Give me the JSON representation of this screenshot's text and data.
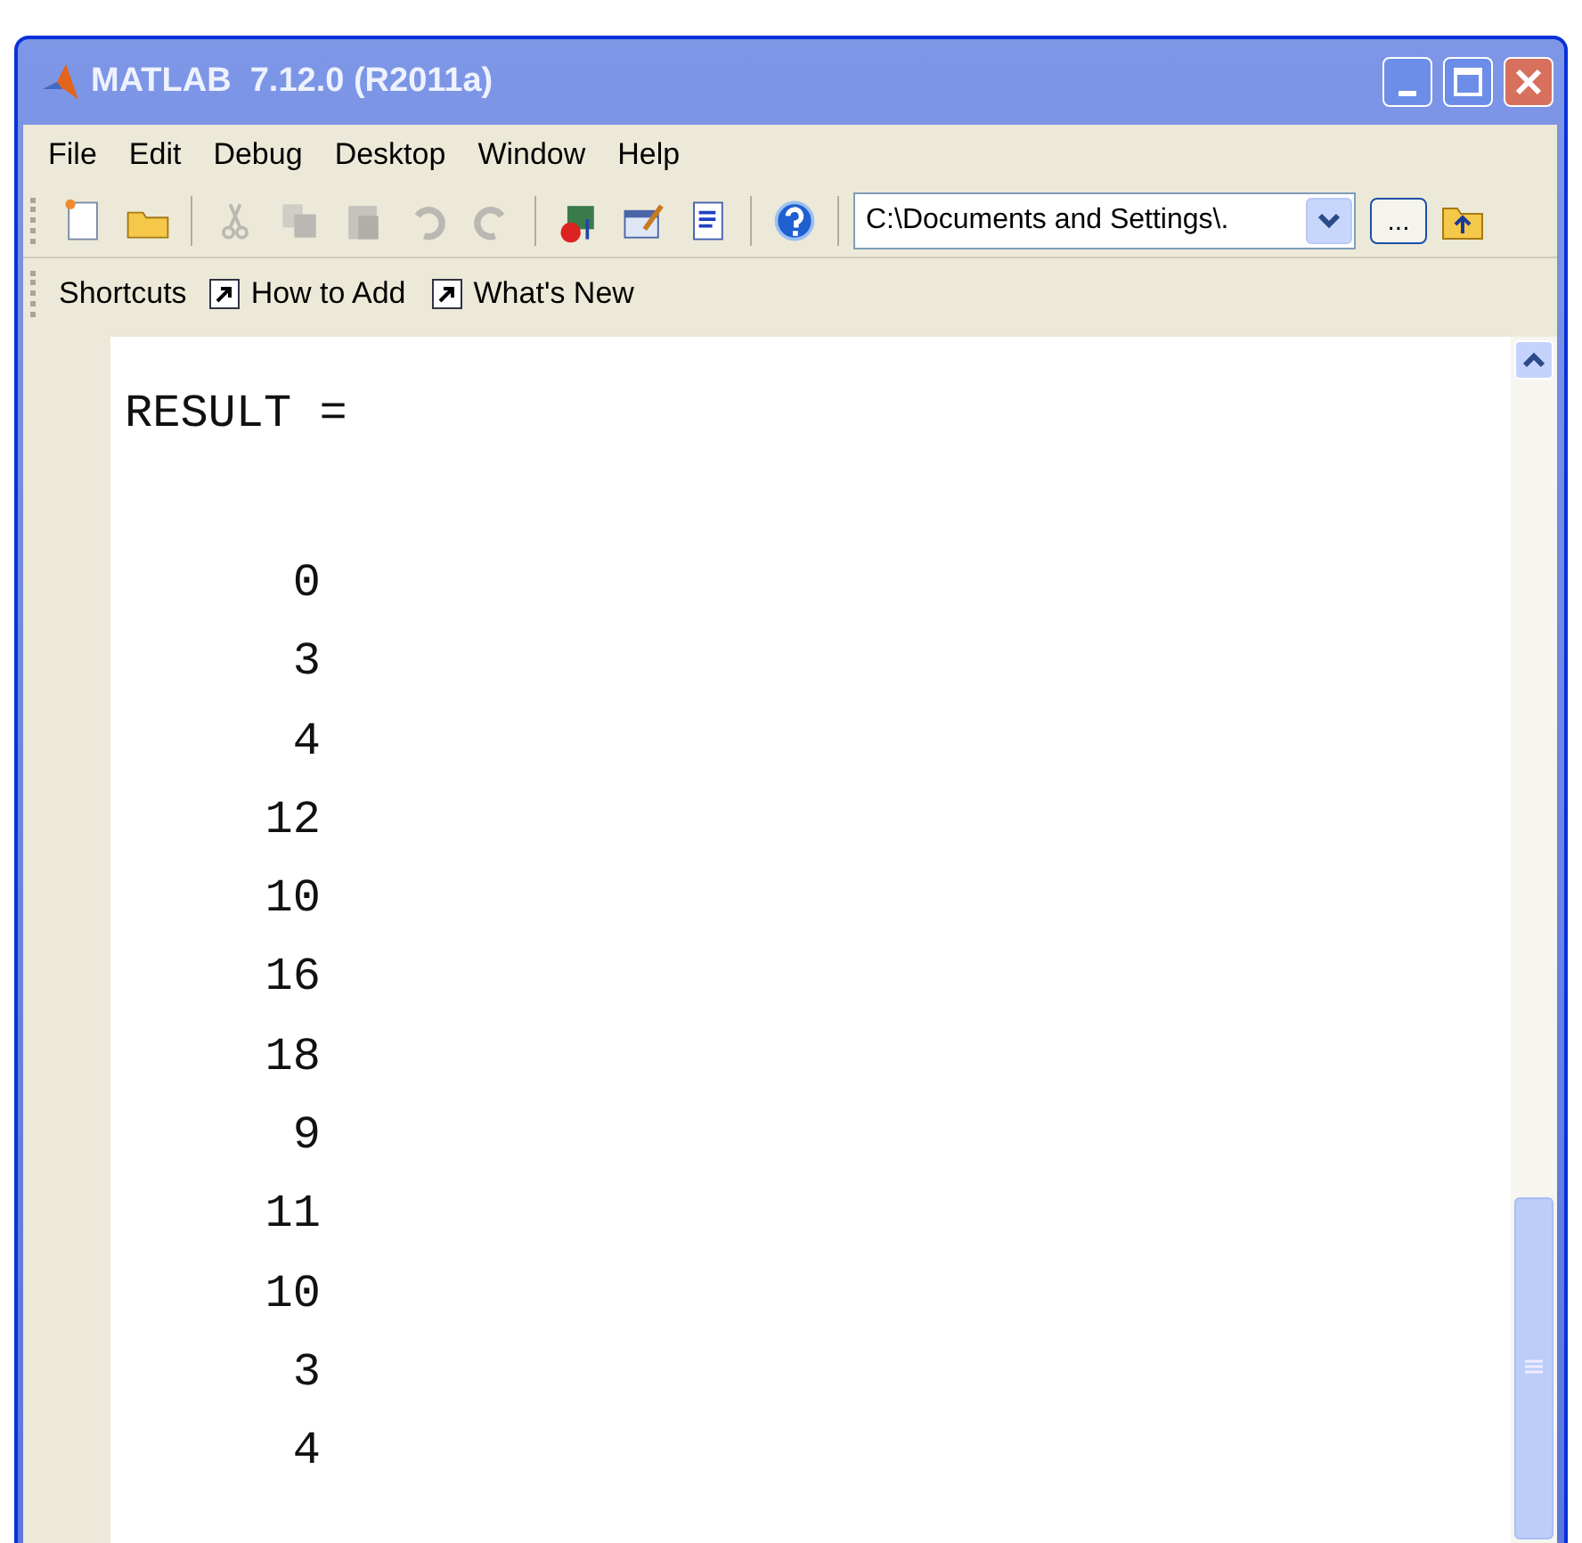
{
  "window": {
    "title": "MATLAB  7.12.0 (R2011a)"
  },
  "menu": [
    "File",
    "Edit",
    "Debug",
    "Desktop",
    "Window",
    "Help"
  ],
  "toolbar": [
    {
      "kind": "newfile",
      "disabled": false
    },
    {
      "kind": "open",
      "disabled": false
    },
    {
      "kind": "sep"
    },
    {
      "kind": "cut",
      "disabled": true
    },
    {
      "kind": "copy",
      "disabled": true
    },
    {
      "kind": "paste",
      "disabled": true
    },
    {
      "kind": "undo",
      "disabled": true
    },
    {
      "kind": "redo",
      "disabled": true
    },
    {
      "kind": "sep"
    },
    {
      "kind": "simulink",
      "disabled": false
    },
    {
      "kind": "guide",
      "disabled": false
    },
    {
      "kind": "profiler",
      "disabled": false
    },
    {
      "kind": "sep"
    },
    {
      "kind": "help",
      "disabled": false
    },
    {
      "kind": "sep"
    }
  ],
  "current_folder": {
    "value": "C:\\Documents and Settings\\.",
    "browse": "..."
  },
  "shortcuts": {
    "label": "Shortcuts",
    "items": [
      "How to Add",
      "What's New"
    ]
  },
  "output": {
    "variable": "RESULT =",
    "values": [
      "0",
      "3",
      "4",
      "12",
      "10",
      "16",
      "18",
      "9",
      "11",
      "10",
      "3",
      "4"
    ]
  }
}
